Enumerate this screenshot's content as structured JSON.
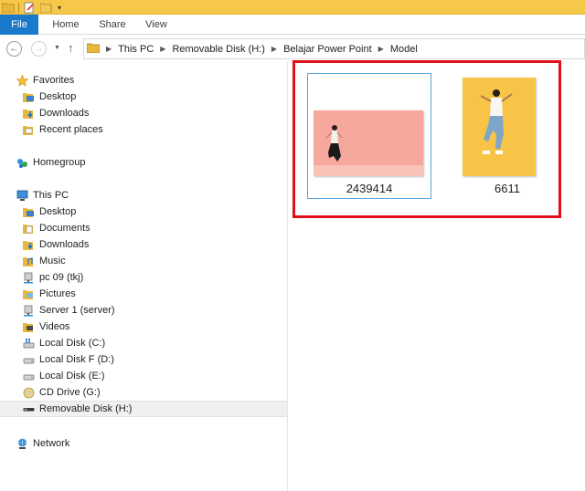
{
  "window": {
    "accent_color": "#1979ca",
    "titlebar_color": "#f5c84a",
    "quick_access_icons": [
      "folder-icon",
      "properties-icon",
      "new-folder-icon",
      "customize-dropdown-icon"
    ]
  },
  "ribbon": {
    "tabs": [
      {
        "label": "File"
      },
      {
        "label": "Home"
      },
      {
        "label": "Share"
      },
      {
        "label": "View"
      }
    ]
  },
  "address": {
    "breadcrumbs": [
      "This PC",
      "Removable Disk (H:)",
      "Belajar Power Point",
      "Model"
    ]
  },
  "navigation": {
    "items": [
      {
        "label": "Favorites",
        "icon": "star-icon"
      },
      {
        "label": "Desktop",
        "icon": "desktop-folder-icon"
      },
      {
        "label": "Downloads",
        "icon": "downloads-folder-icon"
      },
      {
        "label": "Recent places",
        "icon": "recent-places-icon"
      },
      {
        "label": "Homegroup",
        "icon": "homegroup-icon"
      },
      {
        "label": "This PC",
        "icon": "computer-icon"
      },
      {
        "label": "Desktop",
        "icon": "desktop-folder-icon"
      },
      {
        "label": "Documents",
        "icon": "documents-folder-icon"
      },
      {
        "label": "Downloads",
        "icon": "downloads-folder-icon"
      },
      {
        "label": "Music",
        "icon": "music-folder-icon"
      },
      {
        "label": "pc 09 (tkj)",
        "icon": "network-drive-icon"
      },
      {
        "label": "Pictures",
        "icon": "pictures-folder-icon"
      },
      {
        "label": "Server 1 (server)",
        "icon": "network-drive-icon"
      },
      {
        "label": "Videos",
        "icon": "videos-folder-icon"
      },
      {
        "label": "Local Disk (C:)",
        "icon": "system-drive-icon"
      },
      {
        "label": "Local Disk F (D:)",
        "icon": "hard-drive-icon"
      },
      {
        "label": "Local Disk (E:)",
        "icon": "hard-drive-icon"
      },
      {
        "label": "CD Drive (G:)",
        "icon": "cd-drive-icon"
      },
      {
        "label": "Removable Disk (H:)",
        "icon": "removable-disk-icon",
        "selected": true
      },
      {
        "label": "Network",
        "icon": "network-icon"
      }
    ]
  },
  "files": [
    {
      "name": "2439414",
      "selected": true,
      "thumbnail_color": "#f6a89c"
    },
    {
      "name": "6611",
      "selected": false,
      "thumbnail_color": "#f7c447"
    }
  ],
  "highlight_color": "#e0101a"
}
